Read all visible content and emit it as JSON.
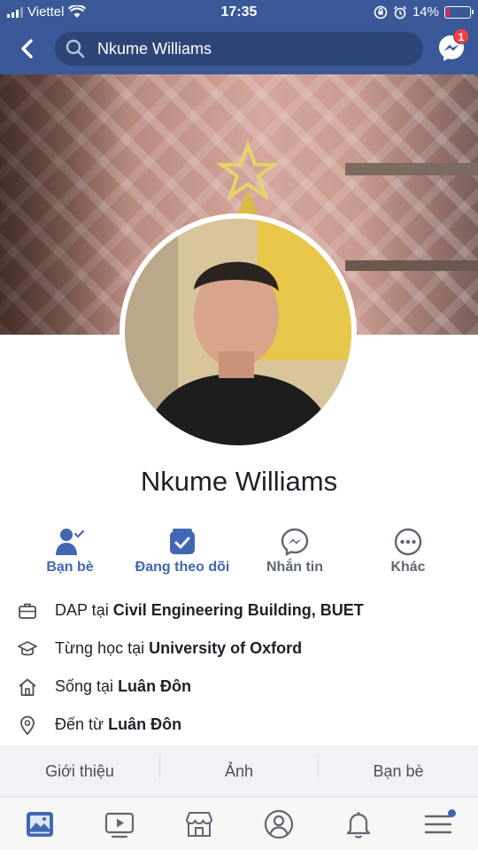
{
  "status_bar": {
    "carrier": "Viettel",
    "time": "17:35",
    "battery_percent": "14%",
    "battery_level": 0.14
  },
  "header": {
    "search_text": "Nkume Williams",
    "messenger_badge": "1"
  },
  "profile": {
    "name": "Nkume Williams"
  },
  "actions": [
    {
      "label": "Bạn bè",
      "icon": "friends-check-icon"
    },
    {
      "label": "Đang theo dõi",
      "icon": "following-feed-icon"
    },
    {
      "label": "Nhắn tin",
      "icon": "messenger-icon"
    },
    {
      "label": "Khác",
      "icon": "more-dots-icon"
    }
  ],
  "info": [
    {
      "icon": "briefcase-icon",
      "prefix": "DAP tại ",
      "value": "Civil Engineering Building, BUET"
    },
    {
      "icon": "graduation-cap-icon",
      "prefix": "Từng học tại ",
      "value": "University of Oxford"
    },
    {
      "icon": "home-icon",
      "prefix": "Sống tại ",
      "value": "Luân Đôn"
    },
    {
      "icon": "location-pin-icon",
      "prefix": "Đến từ ",
      "value": "Luân Đôn"
    }
  ],
  "tabs": [
    "Giới thiệu",
    "Ảnh",
    "Bạn bè"
  ],
  "bottom_nav": [
    {
      "icon": "news-feed-icon",
      "active": true
    },
    {
      "icon": "watch-video-icon"
    },
    {
      "icon": "marketplace-icon"
    },
    {
      "icon": "profile-icon"
    },
    {
      "icon": "notifications-bell-icon"
    },
    {
      "icon": "menu-icon",
      "has_dot": true
    }
  ],
  "colors": {
    "brand_blue": "#3b5998",
    "accent_blue": "#4267b2",
    "badge_red": "#fa3e3e"
  }
}
